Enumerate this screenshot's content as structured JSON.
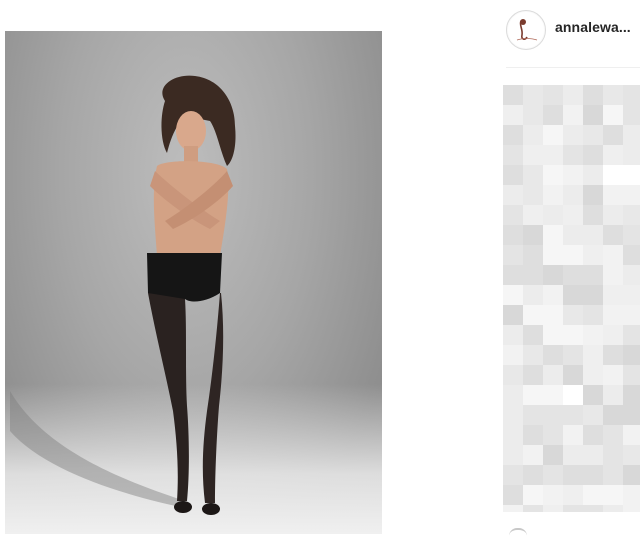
{
  "post": {
    "photo_icon": "photo",
    "photo_description_name": "post-photo"
  },
  "author": {
    "username": "annalewa..."
  },
  "colors": {
    "username": "#262626",
    "divider": "#efefef",
    "background": "#ffffff"
  }
}
